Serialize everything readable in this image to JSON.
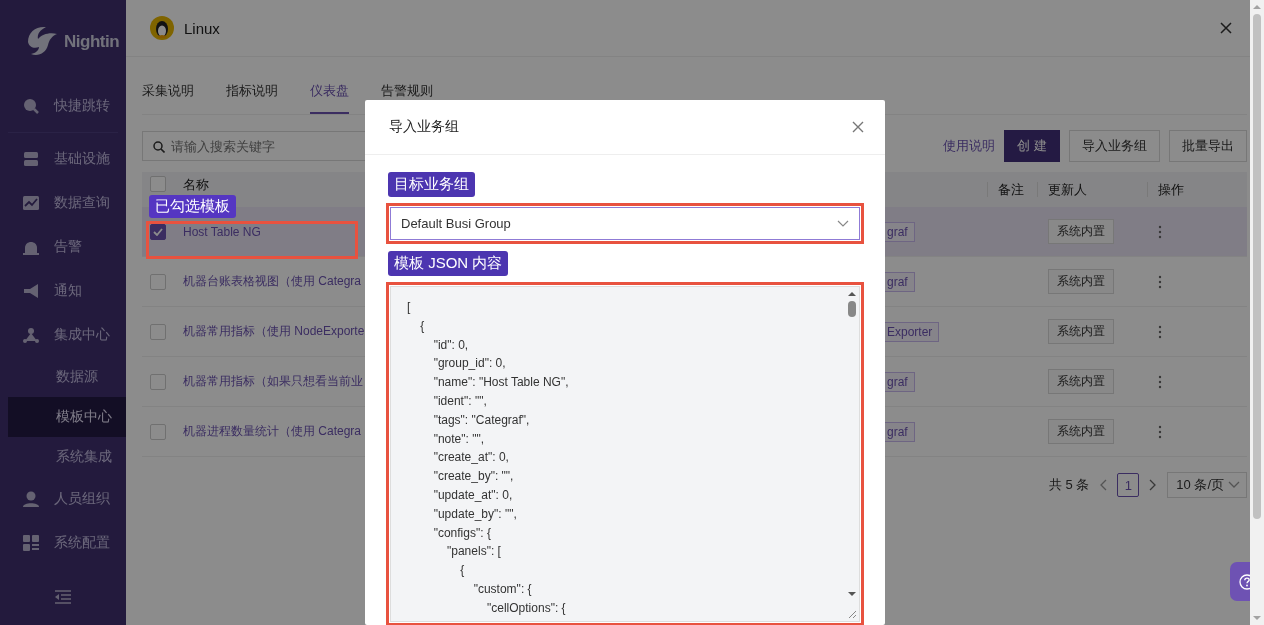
{
  "sidebar": {
    "logo_text": "Nightin",
    "items": [
      {
        "label": "快捷跳转"
      },
      {
        "label": "基础设施"
      },
      {
        "label": "数据查询"
      },
      {
        "label": "告警"
      },
      {
        "label": "通知"
      },
      {
        "label": "集成中心",
        "children": [
          {
            "label": "数据源",
            "selected": false
          },
          {
            "label": "模板中心",
            "selected": true
          },
          {
            "label": "系统集成",
            "selected": false
          }
        ]
      },
      {
        "label": "人员组织"
      },
      {
        "label": "系统配置"
      }
    ]
  },
  "drawer": {
    "title": "Linux",
    "tabs": [
      {
        "label": "采集说明",
        "selected": false
      },
      {
        "label": "指标说明",
        "selected": false
      },
      {
        "label": "仪表盘",
        "selected": true
      },
      {
        "label": "告警规则",
        "selected": false
      }
    ],
    "search": {
      "placeholder": "请输入搜索关键字"
    },
    "help_link": "使用说明",
    "buttons": [
      {
        "label": "创 建",
        "kind": "primary"
      },
      {
        "label": "导入业务组",
        "kind": "default"
      },
      {
        "label": "批量导出",
        "kind": "default"
      }
    ],
    "table": {
      "all_checked": false,
      "columns": [
        "名称",
        "备注",
        "更新人",
        "操作"
      ],
      "rows": [
        {
          "checked": true,
          "selected": true,
          "name": "Host Table NG",
          "tag": "graf",
          "updater": "系统内置"
        },
        {
          "checked": false,
          "selected": false,
          "name": "机器台账表格视图（使用 Categra",
          "tag": "graf",
          "updater": "系统内置"
        },
        {
          "checked": false,
          "selected": false,
          "name": "机器常用指标（使用 NodeExporte",
          "tag": "Exporter",
          "updater": "系统内置"
        },
        {
          "checked": false,
          "selected": false,
          "name": "机器常用指标（如果只想看当前业",
          "tag": "graf",
          "updater": "系统内置"
        },
        {
          "checked": false,
          "selected": false,
          "name": "机器进程数量统计（使用 Categra",
          "tag": "graf",
          "updater": "系统内置"
        }
      ]
    },
    "pagination": {
      "total": "共 5 条",
      "page": "1",
      "page_size": "10 条/页"
    }
  },
  "annotation": {
    "label": "已勾选模板"
  },
  "modal": {
    "title": "导入业务组",
    "fields": [
      {
        "kind": "select",
        "label": "目标业务组",
        "value": "Default Busi Group"
      },
      {
        "kind": "textarea",
        "label": "模板 JSON 内容",
        "value": "[\n    {\n        \"id\": 0,\n        \"group_id\": 0,\n        \"name\": \"Host Table NG\",\n        \"ident\": \"\",\n        \"tags\": \"Categraf\",\n        \"note\": \"\",\n        \"create_at\": 0,\n        \"create_by\": \"\",\n        \"update_at\": 0,\n        \"update_by\": \"\",\n        \"configs\": {\n            \"panels\": [\n                {\n                    \"custom\": {\n                        \"cellOptions\": {"
      }
    ]
  }
}
